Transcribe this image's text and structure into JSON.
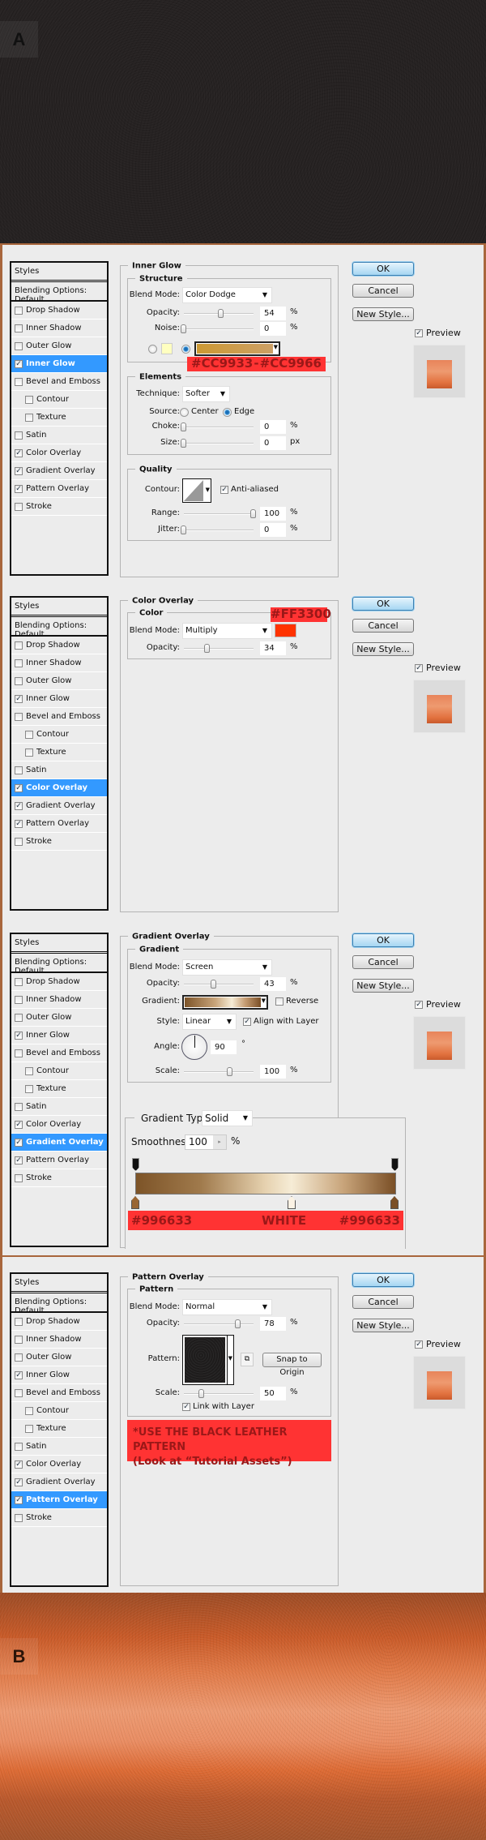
{
  "images": {
    "top_label": "A",
    "bottom_label": "B"
  },
  "sidebar": {
    "header": "Styles",
    "blending": "Blending Options: Default",
    "items": [
      {
        "label": "Drop Shadow",
        "checked": false,
        "sub": false
      },
      {
        "label": "Inner Shadow",
        "checked": false,
        "sub": false
      },
      {
        "label": "Outer Glow",
        "checked": false,
        "sub": false
      },
      {
        "label": "Inner Glow",
        "checked": true,
        "sub": false
      },
      {
        "label": "Bevel and Emboss",
        "checked": false,
        "sub": false
      },
      {
        "label": "Contour",
        "checked": false,
        "sub": true
      },
      {
        "label": "Texture",
        "checked": false,
        "sub": true
      },
      {
        "label": "Satin",
        "checked": false,
        "sub": false
      },
      {
        "label": "Color Overlay",
        "checked": true,
        "sub": false
      },
      {
        "label": "Gradient Overlay",
        "checked": true,
        "sub": false
      },
      {
        "label": "Pattern Overlay",
        "checked": true,
        "sub": false
      },
      {
        "label": "Stroke",
        "checked": false,
        "sub": false
      }
    ]
  },
  "buttons": {
    "ok": "OK",
    "cancel": "Cancel",
    "new_style": "New Style...",
    "preview": "Preview",
    "preview_checked": true
  },
  "panels": [
    {
      "selected_index": 3,
      "title": "Inner Glow",
      "structure": {
        "legend": "Structure",
        "blend_label": "Blend Mode:",
        "blend_mode": "Color Dodge",
        "opacity_label": "Opacity:",
        "opacity": 54,
        "noise_label": "Noise:",
        "noise": 0,
        "unit": "%",
        "solid_color": "#FFFFC0",
        "gradient_colors": [
          "#CC9933",
          "#CC9966"
        ]
      },
      "annotation": {
        "left": "#CC9933",
        "sep": "-",
        "right": "#CC9966"
      },
      "elements": {
        "legend": "Elements",
        "technique_label": "Technique:",
        "technique": "Softer",
        "source_label": "Source:",
        "source_center": "Center",
        "source_edge": "Edge",
        "source_selected": "Edge",
        "choke_label": "Choke:",
        "choke": 0,
        "size_label": "Size:",
        "size": 0,
        "size_unit": "px"
      },
      "quality": {
        "legend": "Quality",
        "contour_label": "Contour:",
        "anti_aliased": "Anti-aliased",
        "anti_aliased_checked": true,
        "range_label": "Range:",
        "range": 100,
        "jitter_label": "Jitter:",
        "jitter": 0
      }
    },
    {
      "selected_index": 8,
      "title": "Color Overlay",
      "color": {
        "legend": "Color",
        "blend_label": "Blend Mode:",
        "blend_mode": "Multiply",
        "swatch": "#FF3300",
        "opacity_label": "Opacity:",
        "opacity": 34,
        "unit": "%"
      },
      "annotation": "#FF3300"
    },
    {
      "selected_index": 9,
      "title": "Gradient Overlay",
      "gradient": {
        "legend": "Gradient",
        "blend_label": "Blend Mode:",
        "blend_mode": "Screen",
        "opacity_label": "Opacity:",
        "opacity": 43,
        "unit": "%",
        "gradient_label": "Gradient:",
        "reverse": "Reverse",
        "reverse_checked": false,
        "style_label": "Style:",
        "style": "Linear",
        "align": "Align with Layer",
        "align_checked": true,
        "angle_label": "Angle:",
        "angle": 90,
        "degree": "°",
        "scale_label": "Scale:",
        "scale": 100
      },
      "editor": {
        "type_label": "Gradient Type:",
        "type": "Solid",
        "smoothness_label": "Smoothness:",
        "smoothness": 100,
        "unit": "%",
        "stops": [
          "#996633",
          "#FFFFFF",
          "#996633"
        ]
      },
      "annotation": {
        "left": "#996633",
        "mid": "WHITE",
        "right": "#996633"
      }
    },
    {
      "selected_index": 10,
      "title": "Pattern Overlay",
      "pattern": {
        "legend": "Pattern",
        "blend_label": "Blend Mode:",
        "blend_mode": "Normal",
        "opacity_label": "Opacity:",
        "opacity": 78,
        "unit": "%",
        "pattern_label": "Pattern:",
        "snap": "Snap to Origin",
        "scale_label": "Scale:",
        "scale": 50,
        "link": "Link with Layer",
        "link_checked": true
      },
      "annotation": {
        "line1": "*USE THE BLACK LEATHER PATTERN",
        "line2": "(Look at “Tutorial Assets”)"
      }
    }
  ]
}
